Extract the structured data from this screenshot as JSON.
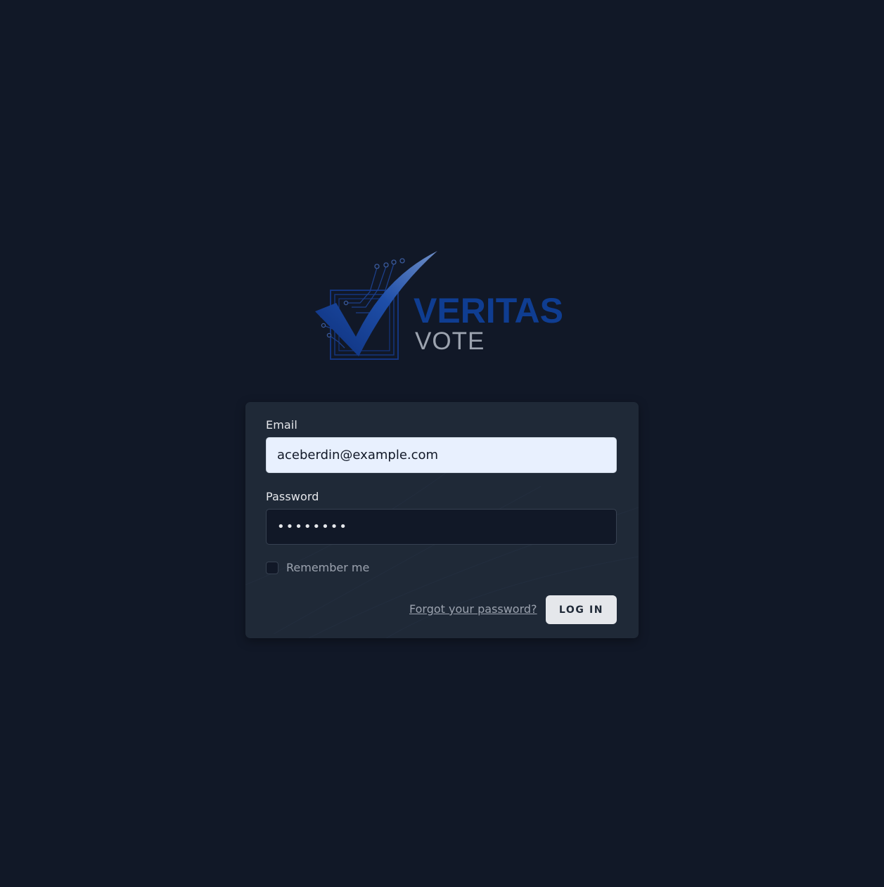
{
  "brand": {
    "name_line1": "VERITAS",
    "name_line2": "VOTE",
    "primary_color": "#0f3d91",
    "secondary_color": "#9ca3af"
  },
  "form": {
    "email": {
      "label": "Email",
      "value": "aceberdin@example.com"
    },
    "password": {
      "label": "Password",
      "value": "••••••••"
    },
    "remember": {
      "label": "Remember me",
      "checked": false
    },
    "forgot_link": "Forgot your password?",
    "submit_label": "LOG IN"
  },
  "colors": {
    "background": "#111827",
    "card": "#1f2937",
    "email_input_bg": "#e8f0fe",
    "button_bg": "#e5e7eb"
  }
}
